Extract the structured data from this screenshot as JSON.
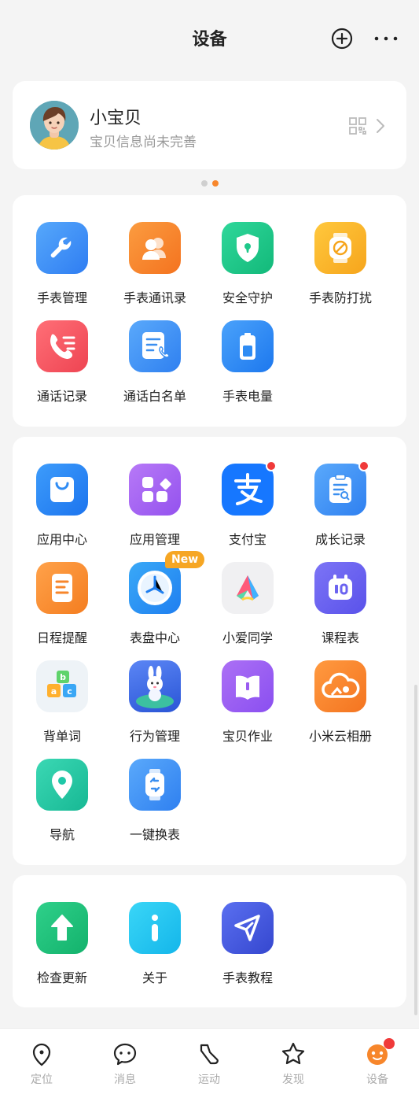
{
  "header": {
    "title": "设备"
  },
  "profile": {
    "name": "小宝贝",
    "subtitle": "宝贝信息尚未完善"
  },
  "section1": [
    {
      "label": "手表管理",
      "icon": "wrench-icon",
      "color": "#3d8df5"
    },
    {
      "label": "手表通讯录",
      "icon": "contacts-icon",
      "color": "#f7862b"
    },
    {
      "label": "安全守护",
      "icon": "shield-icon",
      "color": "#1fc88a"
    },
    {
      "label": "手表防打扰",
      "icon": "do-not-disturb-watch-icon",
      "color": "#f9b524"
    },
    {
      "label": "通话记录",
      "icon": "call-log-icon",
      "color": "#f0505e"
    },
    {
      "label": "通话白名单",
      "icon": "whitelist-icon",
      "color": "#3b8ff0"
    },
    {
      "label": "手表电量",
      "icon": "battery-icon",
      "color": "#2f8cf4"
    }
  ],
  "section2": [
    {
      "label": "应用中心",
      "icon": "app-store-bag-icon",
      "color": "#2f8cf4"
    },
    {
      "label": "应用管理",
      "icon": "app-manage-icon",
      "color": "#a45ef0"
    },
    {
      "label": "支付宝",
      "icon": "alipay-icon",
      "color": "#1677ff",
      "badge": true
    },
    {
      "label": "成长记录",
      "icon": "growth-clipboard-icon",
      "color": "#3b8ff0",
      "badge": true
    },
    {
      "label": "日程提醒",
      "icon": "schedule-icon",
      "color": "#f7862b"
    },
    {
      "label": "表盘中心",
      "icon": "watch-face-icon",
      "color": "#2f9bf4",
      "tag": "New"
    },
    {
      "label": "小爱同学",
      "icon": "xiaoai-icon",
      "color": "#f2f2f2"
    },
    {
      "label": "课程表",
      "icon": "timetable-icon",
      "color": "#6b63f0"
    },
    {
      "label": "背单词",
      "icon": "abc-blocks-icon",
      "color": "#eef3f7"
    },
    {
      "label": "行为管理",
      "icon": "bunny-astronaut-icon",
      "color": "#3a6fe8"
    },
    {
      "label": "宝贝作业",
      "icon": "homework-book-icon",
      "color": "#9b5cf0"
    },
    {
      "label": "小米云相册",
      "icon": "cloud-album-icon",
      "color": "#f7862b"
    },
    {
      "label": "导航",
      "icon": "navigation-pin-icon",
      "color": "#1fc8a8"
    },
    {
      "label": "一键换表",
      "icon": "switch-watch-icon",
      "color": "#3b8ff0"
    }
  ],
  "section3": [
    {
      "label": "检查更新",
      "icon": "update-arrow-icon",
      "color": "#1fc07a"
    },
    {
      "label": "关于",
      "icon": "info-icon",
      "color": "#22c7f0"
    },
    {
      "label": "手表教程",
      "icon": "tutorial-send-icon",
      "color": "#4a5fe0"
    }
  ],
  "nav": [
    {
      "label": "定位",
      "icon": "location-icon"
    },
    {
      "label": "消息",
      "icon": "message-icon"
    },
    {
      "label": "运动",
      "icon": "sport-shoe-icon"
    },
    {
      "label": "发现",
      "icon": "discover-star-icon"
    },
    {
      "label": "设备",
      "icon": "device-icon",
      "active": true
    }
  ],
  "colors": {
    "accent": "#f7862b",
    "badge": "#f03a3a",
    "tag": "#f6a623"
  }
}
